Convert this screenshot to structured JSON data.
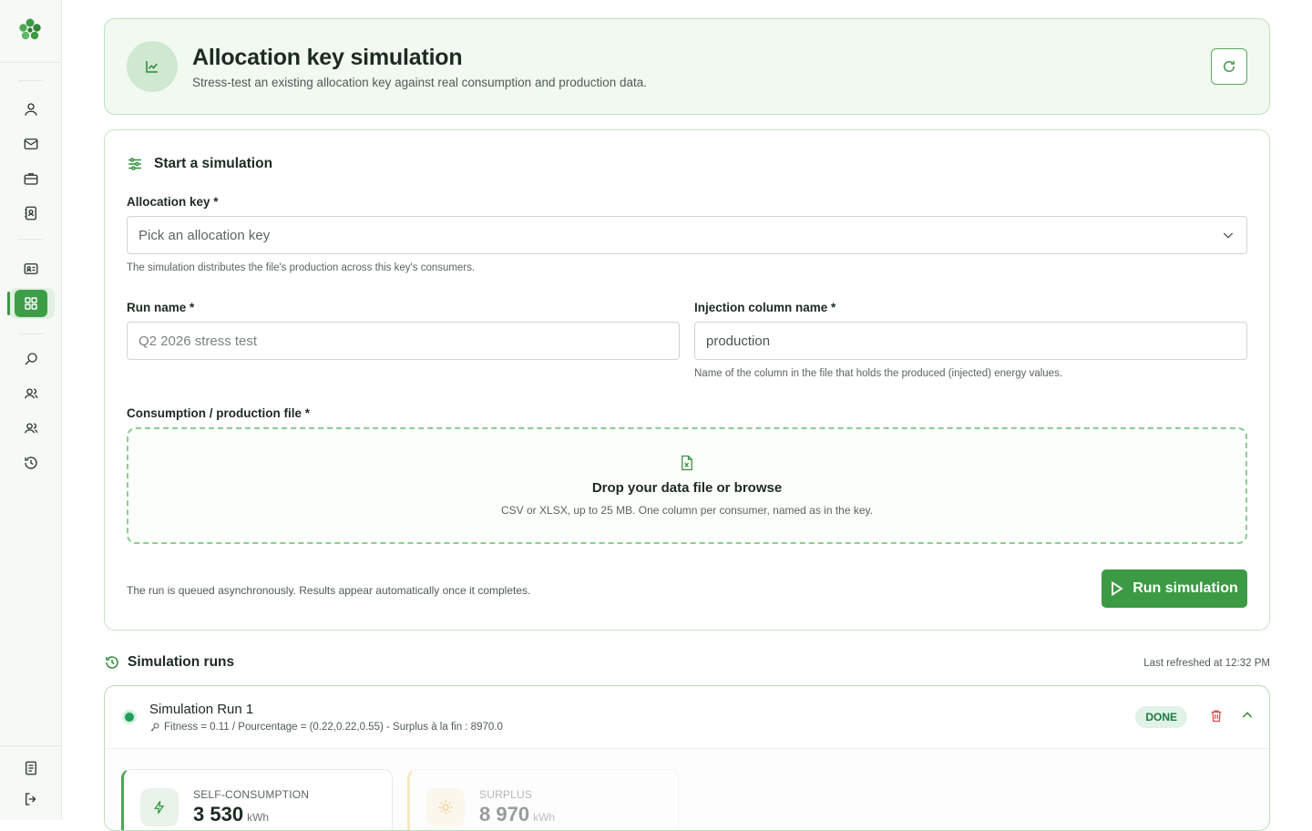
{
  "header": {
    "title": "Allocation key simulation",
    "subtitle": "Stress-test an existing allocation key against real consumption and production data."
  },
  "form": {
    "section_title": "Start a simulation",
    "allocation_key_label": "Allocation key *",
    "allocation_key_placeholder": "Pick an allocation key",
    "allocation_key_hint": "The simulation distributes the file's production across this key's consumers.",
    "run_name_label": "Run name *",
    "run_name_placeholder": "Q2 2026 stress test",
    "injection_label": "Injection column name *",
    "injection_value": "production",
    "injection_hint": "Name of the column in the file that holds the produced (injected) energy values.",
    "file_label": "Consumption / production file *",
    "dropzone_title": "Drop your data file or browse",
    "dropzone_sub": "CSV or XLSX, up to 25 MB. One column per consumer, named as in the key.",
    "footnote": "The run is queued asynchronously. Results appear automatically once it completes.",
    "run_button": "Run simulation"
  },
  "runs": {
    "title": "Simulation runs",
    "last_refreshed": "Last refreshed at 12:32 PM",
    "items": [
      {
        "name": "Simulation Run 1",
        "meta": "Fitness = 0.11 / Pourcentage = (0.22,0.22,0.55) - Surplus à la fin : 8970.0",
        "status": "DONE",
        "stats": [
          {
            "label": "Self-consumption",
            "value": "3 530",
            "unit": "kWh"
          },
          {
            "label": "Surplus",
            "value": "8 970",
            "unit": "kWh"
          }
        ]
      }
    ]
  },
  "colors": {
    "accent": "#3c9a44",
    "status_done": "#1f9d5c",
    "danger": "#d84a4a"
  },
  "icons": {
    "sidebar": [
      "user-icon",
      "mail-icon",
      "briefcase-icon",
      "contact-book-icon",
      "id-card-icon",
      "grid-icon",
      "search-icon",
      "users-icon",
      "group-icon",
      "history-icon",
      "document-icon",
      "logout-icon"
    ]
  }
}
